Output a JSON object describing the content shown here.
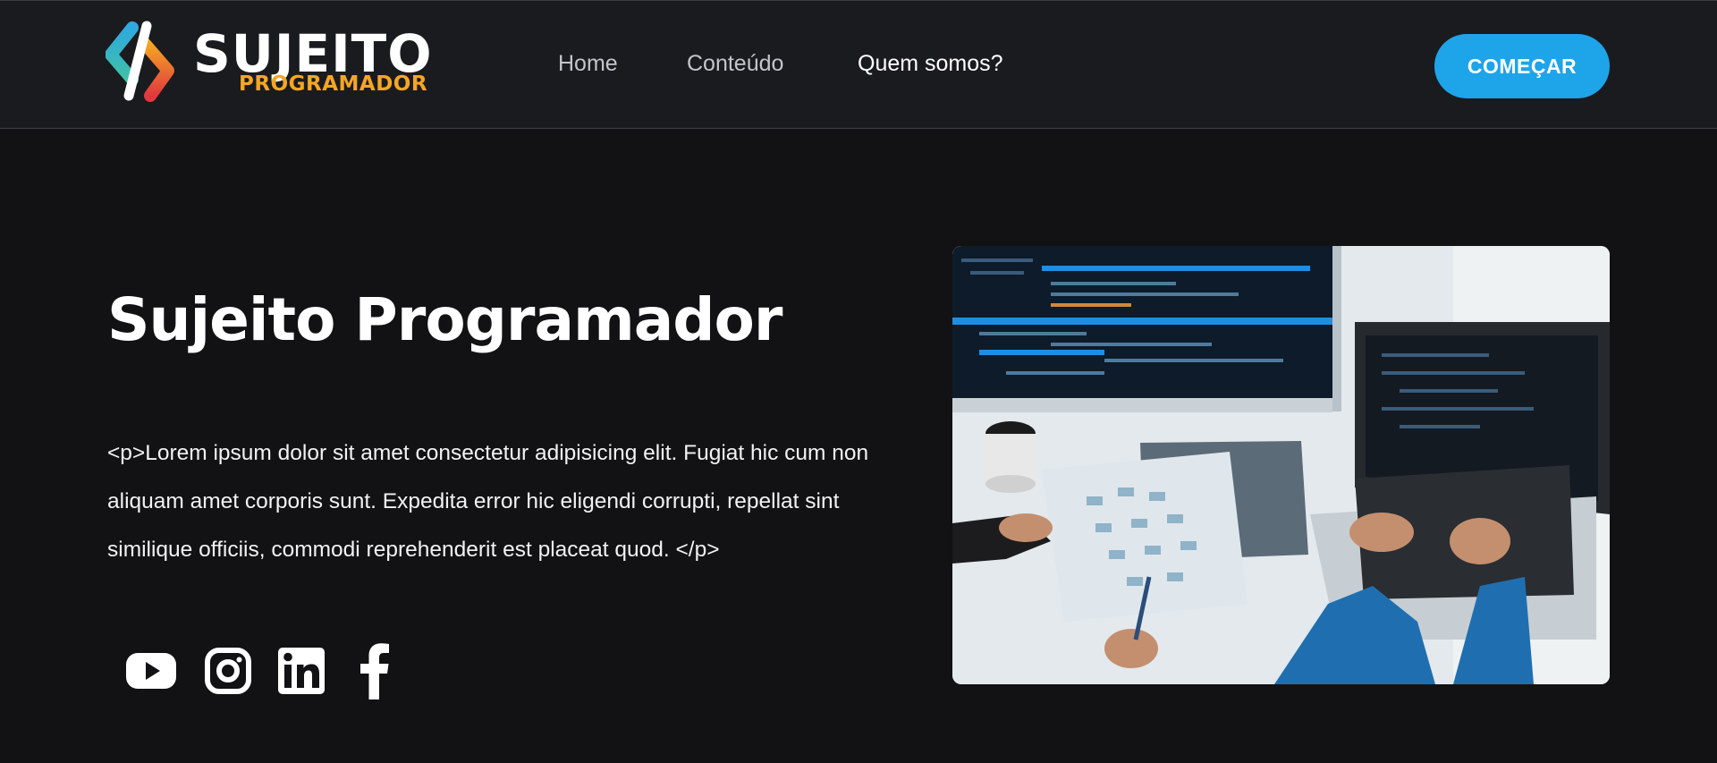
{
  "brand": {
    "name": "SUJEITO",
    "tagline": "PROGRAMADOR"
  },
  "nav": {
    "items": [
      {
        "label": "Home",
        "active": false
      },
      {
        "label": "Conteúdo",
        "active": false
      },
      {
        "label": "Quem somos?",
        "active": true
      }
    ]
  },
  "header": {
    "cta_label": "COMEÇAR"
  },
  "hero": {
    "title": "Sujeito Programador",
    "paragraph": "<p>Lorem ipsum dolor sit amet consectetur adipisicing elit. Fugiat hic cum non aliquam amet corporis sunt. Expedita error hic eligendi corrupti, repellat sint similique officiis, commodi reprehenderit est placeat quod. </p>"
  },
  "social": {
    "icons": [
      "youtube-icon",
      "instagram-icon",
      "linkedin-icon",
      "facebook-icon"
    ]
  },
  "colors": {
    "background": "#121214",
    "header_bg": "#1a1b1f",
    "accent": "#1ea4e9",
    "brand_orange": "#f5a623",
    "nav_text": "#c4c4cc"
  }
}
